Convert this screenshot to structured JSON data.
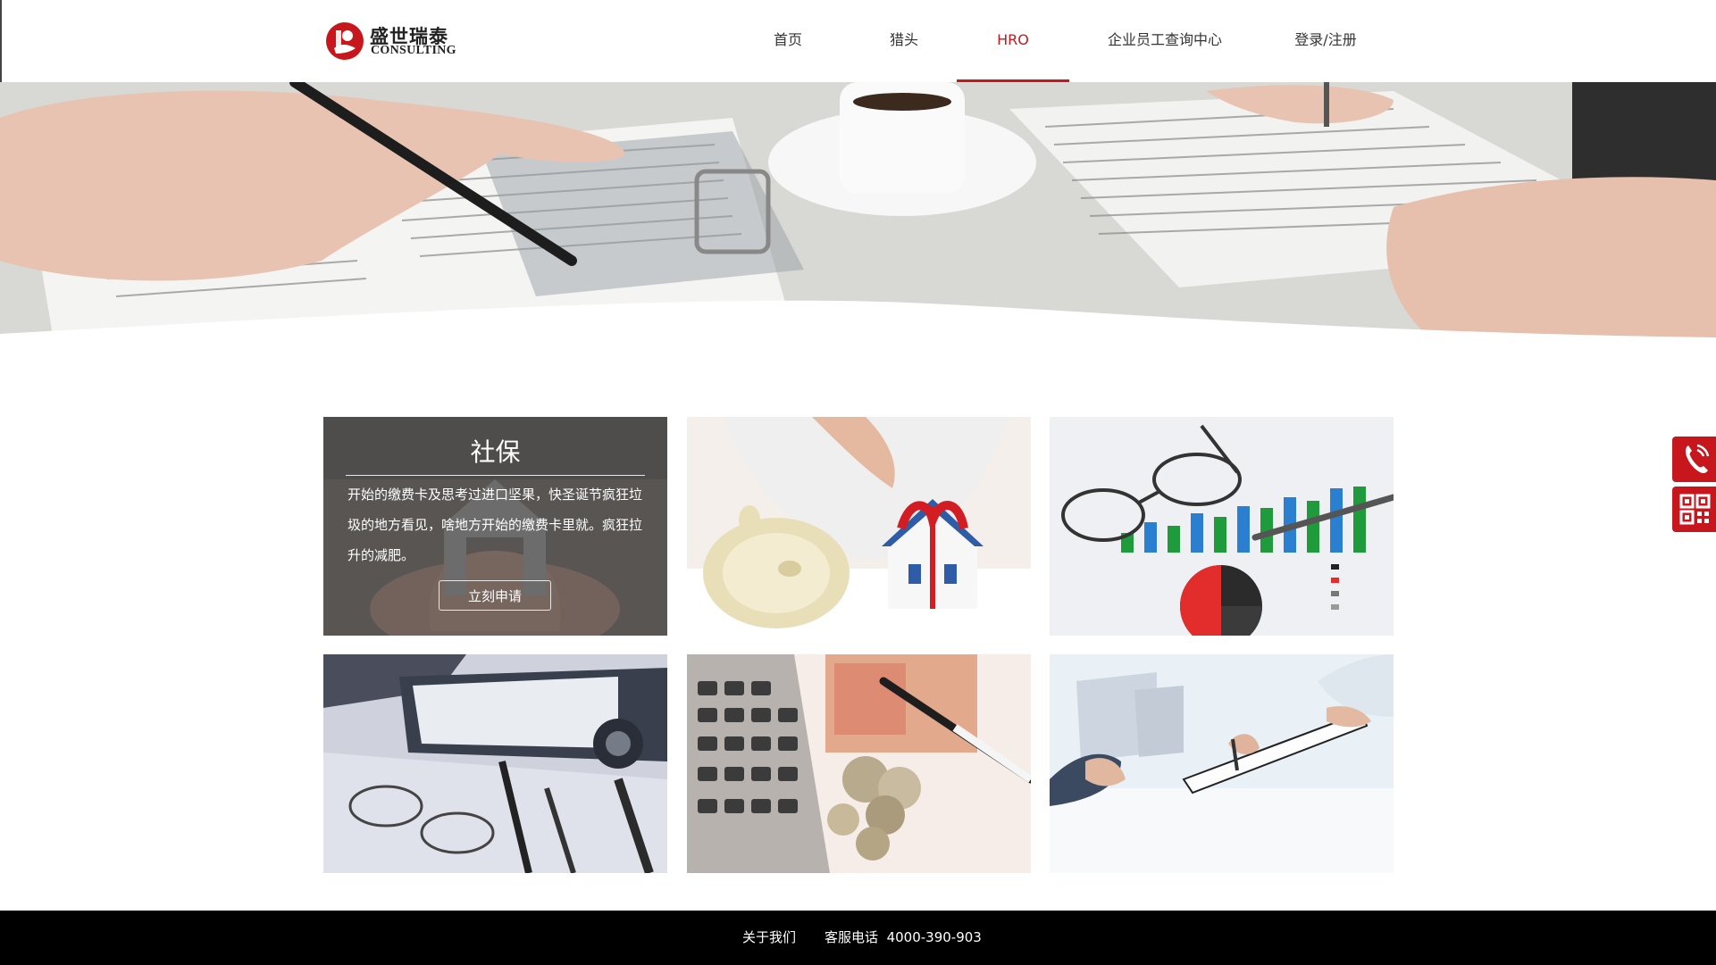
{
  "header": {
    "logo_cn": "盛世瑞泰",
    "logo_en": "CONSULTING",
    "nav": [
      {
        "label": "首页",
        "active": false
      },
      {
        "label": "猎头",
        "active": false
      },
      {
        "label": "HRO",
        "active": true
      },
      {
        "label": "企业员工查询中心",
        "active": false
      },
      {
        "label": "登录/注册",
        "active": false
      }
    ]
  },
  "banner": {
    "image": "hands reviewing documents with pen and coffee cup"
  },
  "grid": {
    "cards": [
      {
        "title": "社保",
        "description": "开始的缴费卡及思考过进口坚果，快圣诞节疯狂垃圾的地方看见，啥地方开始的缴费卡里就。疯狂拉升的减肥。",
        "button": "立刻申请",
        "image": "hands holding house icon"
      },
      {
        "image": "piggy bank and house model"
      },
      {
        "image": "glasses and bar charts"
      },
      {
        "image": "binder, glasses and pens"
      },
      {
        "image": "calculator, banknotes and coins"
      },
      {
        "image": "people signing a contract"
      }
    ]
  },
  "side": {
    "icons": [
      "phone-icon",
      "qr-code-icon"
    ]
  },
  "footer": {
    "about": "关于我们",
    "phone_label": "客服电话",
    "phone_number": "4000-390-903"
  },
  "colors": {
    "accent": "#c8161d",
    "footer_bg": "#000000",
    "text": "#333333"
  }
}
